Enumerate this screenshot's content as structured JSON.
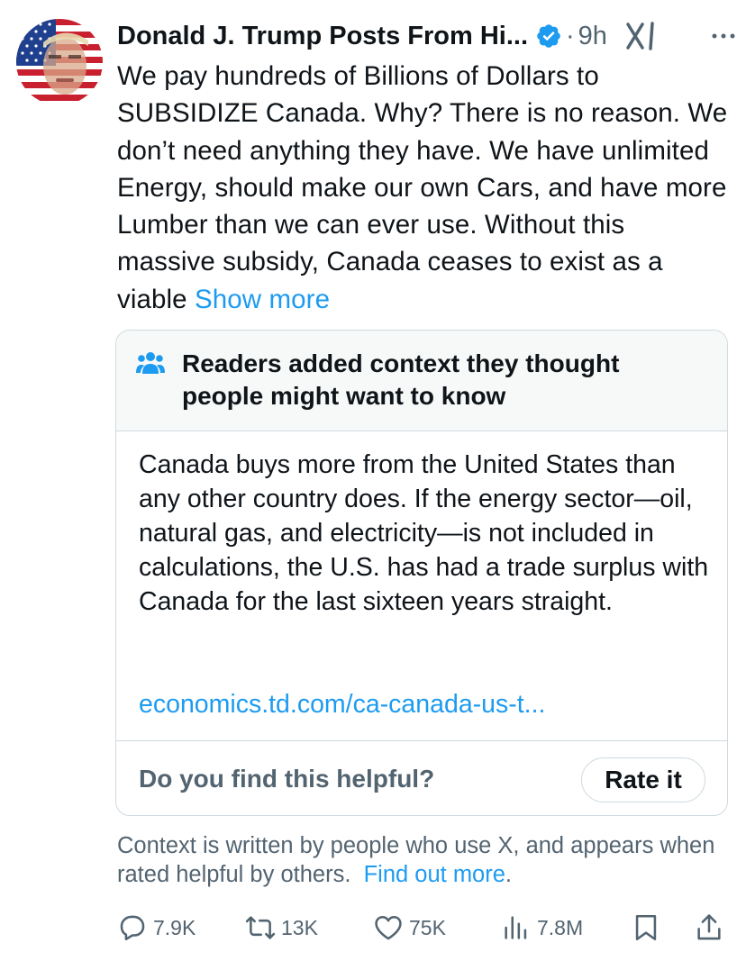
{
  "author": {
    "name": "Donald J. Trump Posts From Hi...",
    "separator": "·",
    "time": "9h"
  },
  "tweet": {
    "text": "We pay hundreds of Billions of Dollars to SUBSIDIZE Canada. Why? There is no reason. We don’t need anything they have. We have unlimited Energy, should make our own Cars, and have more Lumber than we can ever use. Without this massive subsidy, Canada ceases to exist as a viable",
    "show_more": "Show more"
  },
  "note": {
    "title": "Readers added context they thought people might want to know",
    "body": "Canada buys more from the United States than any other country does. If the energy sector—oil, natural gas, and electricity—is not included in calculations, the U.S. has had a trade surplus with Canada for the last sixteen years straight.",
    "link": "economics.td.com/ca-canada-us-t...",
    "helpful_question": "Do you find this helpful?",
    "rate_label": "Rate it"
  },
  "disclaimer": {
    "text": "Context is written by people who use X, and appears when rated helpful by others.",
    "link": "Find out more",
    "period": "."
  },
  "actions": {
    "replies": "7.9K",
    "reposts": "13K",
    "likes": "75K",
    "views": "7.8M"
  },
  "icons": {
    "avatar": "avatar-flag-portrait",
    "verified": "verified-badge-icon",
    "grok": "grok-icon",
    "more": "more-icon",
    "people": "people-icon",
    "reply": "reply-icon",
    "repost": "repost-icon",
    "like": "like-icon",
    "views": "views-icon",
    "bookmark": "bookmark-icon",
    "share": "share-icon"
  },
  "colors": {
    "link": "#1d9bf0",
    "secondary_text": "#536471",
    "border": "#cfd9de",
    "note_header_bg": "#f7f9f9"
  }
}
